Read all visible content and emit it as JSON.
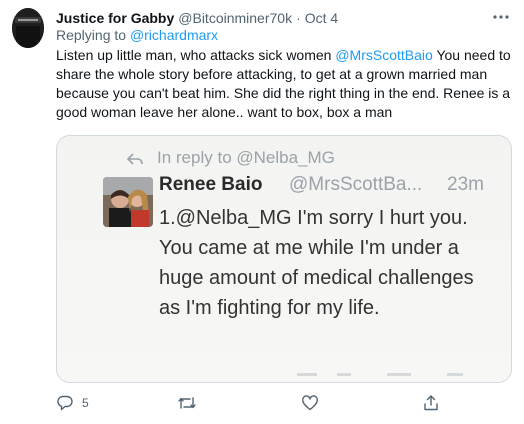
{
  "tweet": {
    "author_name": "Justice for Gabby",
    "handle": "@Bitcoinminer70k",
    "separator": "·",
    "date": "Oct 4",
    "more_icon": "more-horizontal-icon",
    "reply_prefix": "Replying to",
    "reply_to": "@richardmarx",
    "body_part1": "Listen up little man, who attacks sick women ",
    "body_mention": "@MrsScottBaio",
    "body_part2": "  You need to share the whole story before attacking, to get at a grown married man because you can't beat him.  She did the right thing in the end. Renee is a good woman leave her alone.. want to box, box a man"
  },
  "media": {
    "in_reply": "In reply to @Nelba_MG",
    "inner_name": "Renee Baio",
    "inner_handle": "@MrsScottBa...",
    "inner_time": "23m",
    "inner_text": "1.@Nelba_MG I'm sorry I hurt you. You came at me while I'm under a huge amount of medical challenges as I'm fighting for my life."
  },
  "actions": {
    "reply_count": "5",
    "icons": [
      "reply-icon",
      "retweet-icon",
      "like-icon",
      "share-icon"
    ]
  },
  "colors": {
    "link": "#1d9bf0",
    "secondary_text": "#536471",
    "border": "#cfd9de"
  }
}
